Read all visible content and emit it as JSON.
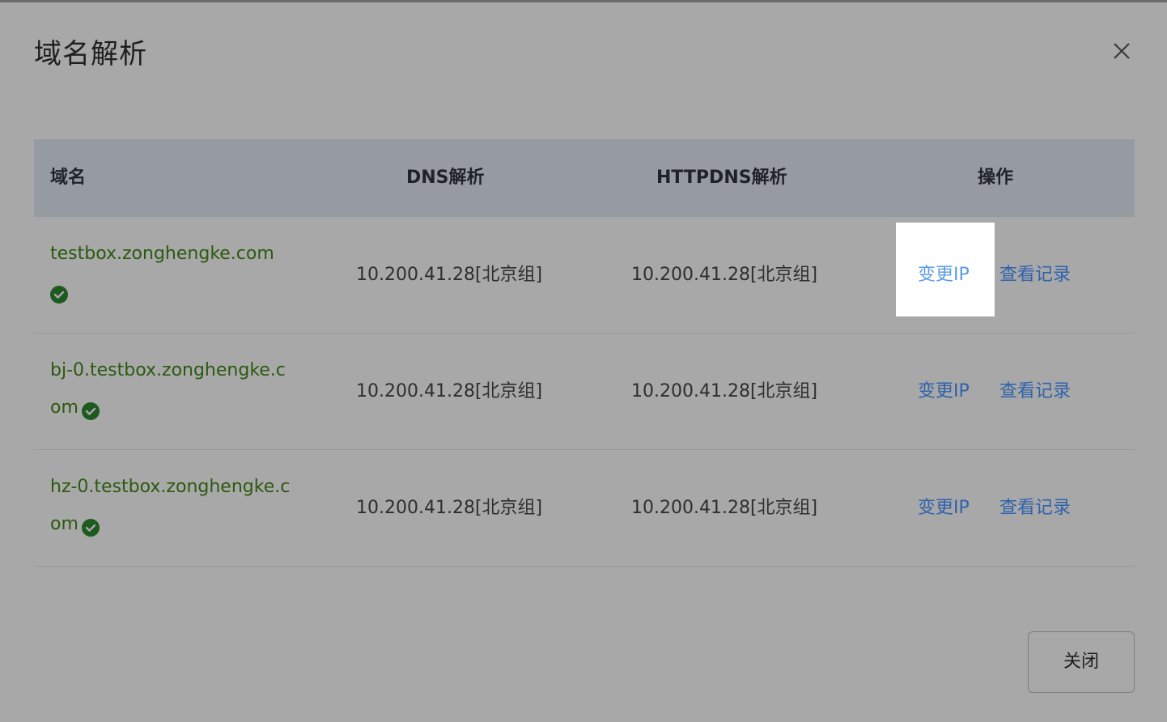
{
  "dialog": {
    "title": "域名解析",
    "close_button_label": "关闭"
  },
  "table": {
    "headers": {
      "domain": "域名",
      "dns": "DNS解析",
      "httpdns": "HTTPDNS解析",
      "actions": "操作"
    },
    "rows": [
      {
        "domain": "testbox.zonghengke.com",
        "dns": "10.200.41.28[北京组]",
        "httpdns": "10.200.41.28[北京组]",
        "change_ip": "变更IP",
        "view_log": "查看记录"
      },
      {
        "domain": "bj-0.testbox.zonghengke.com",
        "dns": "10.200.41.28[北京组]",
        "httpdns": "10.200.41.28[北京组]",
        "change_ip": "变更IP",
        "view_log": "查看记录"
      },
      {
        "domain": "hz-0.testbox.zonghengke.com",
        "dns": "10.200.41.28[北京组]",
        "httpdns": "10.200.41.28[北京组]",
        "change_ip": "变更IP",
        "view_log": "查看记录"
      }
    ]
  },
  "icons": {
    "status": "check-circle-icon",
    "close": "close-icon"
  },
  "colors": {
    "overlay_gray": "#a8a8a8",
    "header_bg": "#969ba2",
    "domain_green": "#2b5a10",
    "link_blue": "#2f62ac",
    "highlight_link_blue": "#5b9be6",
    "check_green": "#1d5a1f"
  }
}
